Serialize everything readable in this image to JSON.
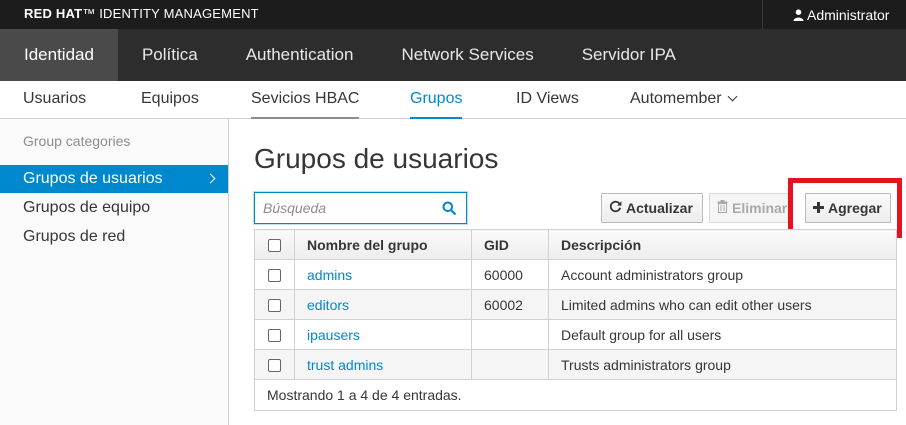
{
  "masthead": {
    "brand_bold": "RED HAT",
    "brand_rest": "IDENTITY MANAGEMENT",
    "user": "Administrator"
  },
  "nav_primary": [
    {
      "label": "Identidad",
      "active": true
    },
    {
      "label": "Política"
    },
    {
      "label": "Authentication"
    },
    {
      "label": "Network Services"
    },
    {
      "label": "Servidor IPA"
    }
  ],
  "nav_secondary": [
    {
      "label": "Usuarios"
    },
    {
      "label": "Equipos"
    },
    {
      "label": "Sevicios HBAC"
    },
    {
      "label": "Grupos",
      "active": true
    },
    {
      "label": "ID Views"
    },
    {
      "label": "Automember"
    }
  ],
  "sidebar": {
    "heading": "Group categories",
    "items": [
      {
        "label": "Grupos de usuarios",
        "active": true
      },
      {
        "label": "Grupos de equipo"
      },
      {
        "label": "Grupos de red"
      }
    ]
  },
  "main": {
    "title": "Grupos de usuarios",
    "search_placeholder": "Búsqueda",
    "buttons": {
      "refresh": "Actualizar",
      "delete": "Eliminar",
      "add": "Agregar"
    },
    "table": {
      "headers": [
        "Nombre del grupo",
        "GID",
        "Descripción"
      ],
      "rows": [
        {
          "name": "admins",
          "gid": "60000",
          "description": "Account administrators group"
        },
        {
          "name": "editors",
          "gid": "60002",
          "description": "Limited admins who can edit other users"
        },
        {
          "name": "ipausers",
          "gid": "",
          "description": "Default group for all users"
        },
        {
          "name": "trust admins",
          "gid": "",
          "description": "Trusts administrators group"
        }
      ],
      "footer": "Mostrando 1 a 4 de 4 entradas."
    }
  },
  "colors": {
    "accent": "#0088ce",
    "highlight": "#e3141f",
    "masthead": "#1c1c1c",
    "nav": "#2d2d2d"
  }
}
